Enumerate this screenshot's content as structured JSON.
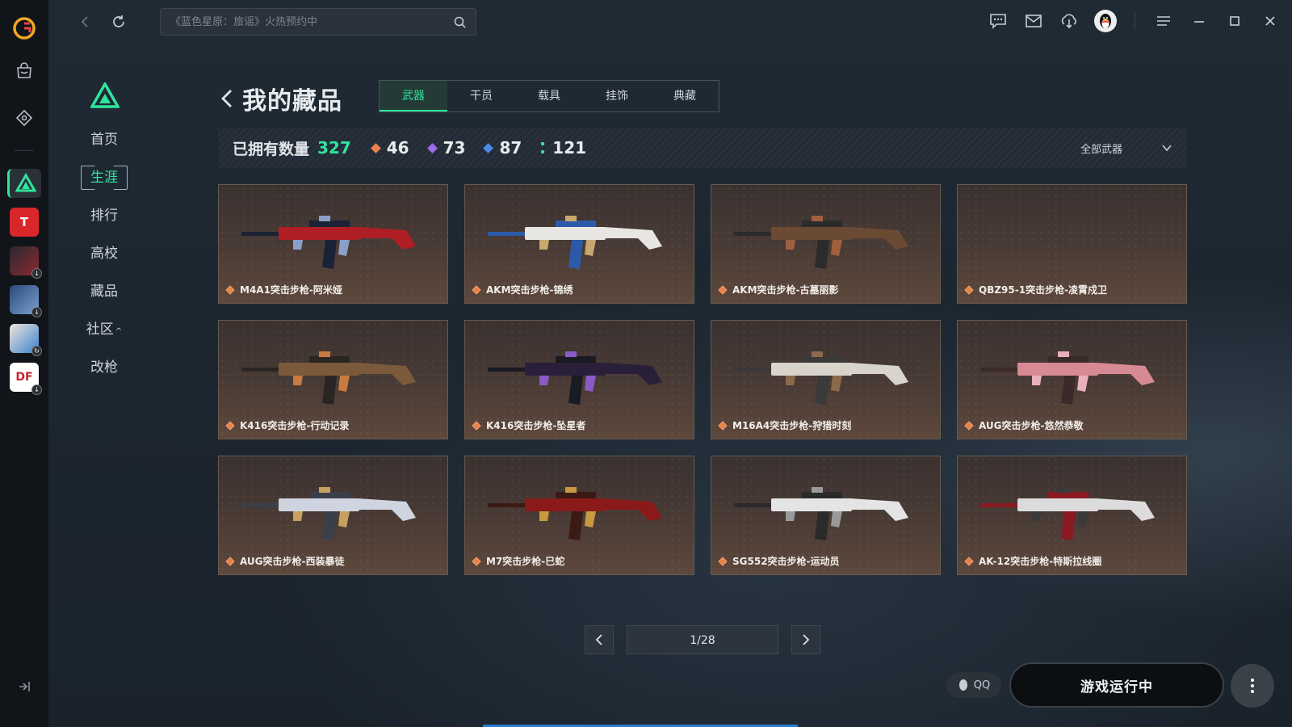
{
  "topbar": {
    "search_placeholder": "《蓝色星原：旅谣》火热预约中"
  },
  "rail": {
    "games": [
      {
        "name": "delta-force",
        "active": true
      },
      {
        "name": "game-tt",
        "color": "#d9262a",
        "label": "T"
      },
      {
        "name": "game-mech",
        "color": "#7a2a30",
        "label": ""
      },
      {
        "name": "game-blue",
        "color": "#355c8f",
        "label": ""
      },
      {
        "name": "game-chibi",
        "color": "#e9e0d4",
        "label": ""
      },
      {
        "name": "game-df",
        "color": "#c72630",
        "label": "DF"
      }
    ]
  },
  "section_nav": {
    "items": [
      {
        "label": "首页"
      },
      {
        "label": "生涯",
        "active": true
      },
      {
        "label": "排行"
      },
      {
        "label": "高校"
      },
      {
        "label": "藏品"
      },
      {
        "label": "社区"
      },
      {
        "label": "改枪"
      }
    ],
    "community_caret": "^"
  },
  "page": {
    "title": "我的藏品",
    "tabs": [
      "武器",
      "干员",
      "载具",
      "挂饰",
      "典藏"
    ],
    "active_tab": "武器"
  },
  "stats": {
    "label": "已拥有数量",
    "total": "327",
    "tiers": [
      {
        "color": "#e8824a",
        "value": "46"
      },
      {
        "color": "#9c6cf0",
        "value": "73"
      },
      {
        "color": "#4a8ae8",
        "value": "87"
      },
      {
        "color": "#2ee59d",
        "value": "121"
      }
    ],
    "filter": "全部武器"
  },
  "items": [
    {
      "name": "M4A1突击步枪-阿米娅",
      "colors": [
        "#b01e25",
        "#1a2235",
        "#8aa0c8"
      ]
    },
    {
      "name": "AKM突击步枪-锦绣",
      "colors": [
        "#e8e6e2",
        "#2d5aa8",
        "#c8a870"
      ]
    },
    {
      "name": "AKM突击步枪-古墓丽影",
      "colors": [
        "#6b4a34",
        "#2b2b2b",
        "#a06040"
      ]
    },
    {
      "name": "QBZ95-1突击步枪-凌霄戍卫",
      "colors": []
    },
    {
      "name": "K416突击步枪-行动记录",
      "colors": [
        "#7a5a3a",
        "#2a2522",
        "#c87a40"
      ]
    },
    {
      "name": "K416突击步枪-坠星者",
      "colors": [
        "#2a1f3a",
        "#1a1a22",
        "#8a5ac8"
      ]
    },
    {
      "name": "M16A4突击步枪-狩猎时刻",
      "colors": [
        "#d8d4cc",
        "#3a3a3a",
        "#8a6a4a"
      ]
    },
    {
      "name": "AUG突击步枪-悠然恭敬",
      "colors": [
        "#d88a94",
        "#3a2a2a",
        "#e8b0b8"
      ]
    },
    {
      "name": "AUG突击步枪-西装暴徒",
      "colors": [
        "#d0d4e0",
        "#3a3f4a",
        "#c8a060"
      ]
    },
    {
      "name": "M7突击步枪-巳蛇",
      "colors": [
        "#8a1a1a",
        "#3a1a12",
        "#c89a40"
      ]
    },
    {
      "name": "SG552突击步枪-运动员",
      "colors": [
        "#e4e4e4",
        "#2a2a2a",
        "#9a9a9a"
      ]
    },
    {
      "name": "AK-12突击步枪-特斯拉线圈",
      "colors": [
        "#dcdcdc",
        "#8a1a22",
        "#3a3a3a"
      ]
    }
  ],
  "pager": {
    "page": "1/28"
  },
  "footer": {
    "qq_label": "QQ",
    "run_label": "游戏运行中"
  }
}
